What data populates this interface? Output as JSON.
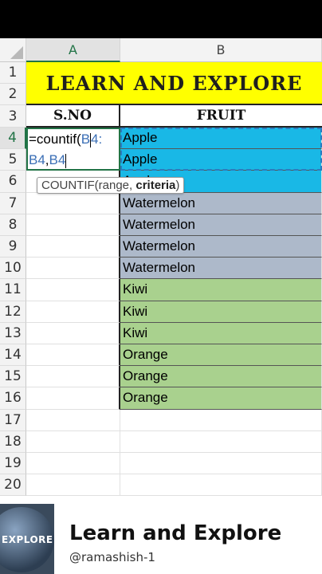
{
  "columns": [
    "A",
    "B"
  ],
  "rows": [
    "1",
    "2",
    "3",
    "4",
    "5",
    "6",
    "7",
    "8",
    "9",
    "10",
    "11",
    "12",
    "13",
    "14",
    "15",
    "16",
    "17",
    "18",
    "19",
    "20"
  ],
  "title": "LEARN AND EXPLORE",
  "headers": {
    "sno": "S.NO",
    "fruit": "FRUIT"
  },
  "formula": {
    "prefix": "=countif(",
    "ref1": "B4:",
    "ref2": "B4",
    "comma": ",",
    "line1_ref_start": "B",
    "line1_ref_end": "4:"
  },
  "tooltip": {
    "func": "COUNTIF(range, ",
    "arg": "criteria",
    "close": ")"
  },
  "fruits": [
    "Apple",
    "Apple",
    "Apple",
    "Watermelon",
    "Watermelon",
    "Watermelon",
    "Watermelon",
    "Kiwi",
    "Kiwi",
    "Kiwi",
    "Orange",
    "Orange",
    "Orange"
  ],
  "fruit_colors": {
    "Apple": "#19b8e6",
    "Watermelon": "#adb9ca",
    "Kiwi": "#a9d18e",
    "Orange": "#a9d18e"
  },
  "footer": {
    "logo_text": "EXPLORE",
    "brand": "Learn and Explore",
    "handle": "@ramashish-1"
  }
}
